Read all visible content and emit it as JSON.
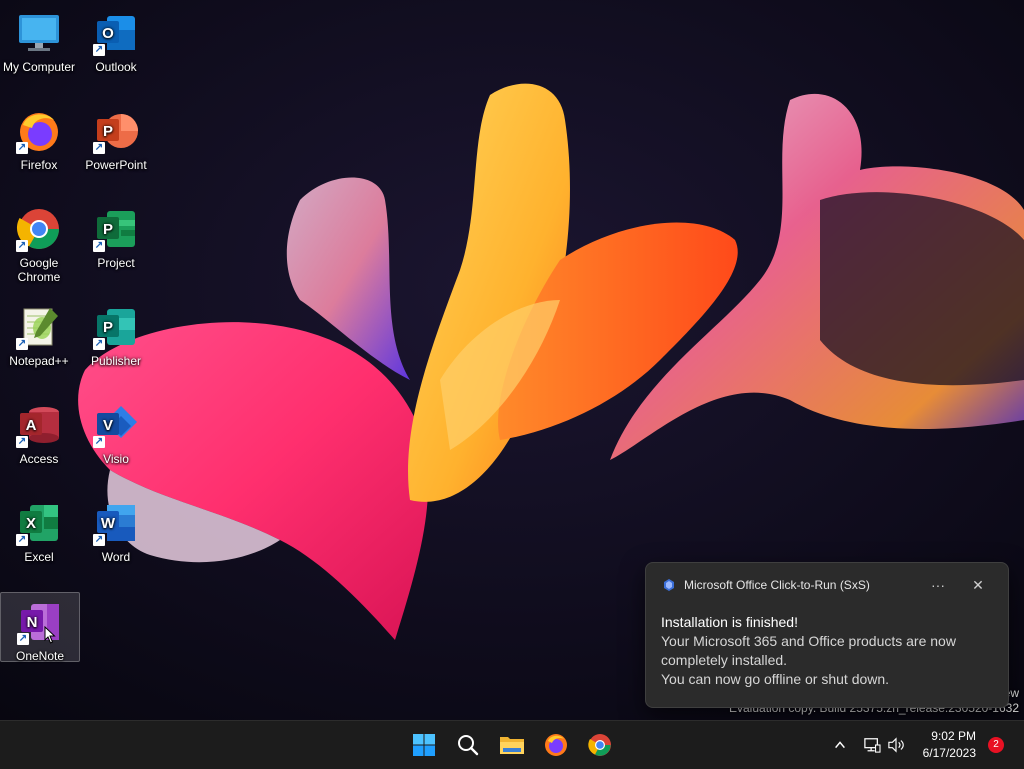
{
  "desktop": {
    "icons": [
      {
        "label": "My Computer",
        "icon": "computer-icon"
      },
      {
        "label": "Outlook",
        "icon": "outlook-icon"
      },
      {
        "label": "Firefox",
        "icon": "firefox-icon"
      },
      {
        "label": "PowerPoint",
        "icon": "powerpoint-icon"
      },
      {
        "label": "Google Chrome",
        "icon": "chrome-icon"
      },
      {
        "label": "Project",
        "icon": "project-icon"
      },
      {
        "label": "Notepad++",
        "icon": "notepadpp-icon"
      },
      {
        "label": "Publisher",
        "icon": "publisher-icon"
      },
      {
        "label": "Access",
        "icon": "access-icon"
      },
      {
        "label": "Visio",
        "icon": "visio-icon"
      },
      {
        "label": "Excel",
        "icon": "excel-icon"
      },
      {
        "label": "Word",
        "icon": "word-icon"
      },
      {
        "label": "OneNote",
        "icon": "onenote-icon"
      }
    ]
  },
  "watermark": {
    "line1": "ew",
    "line2": "Evaluation copy. Build 25375.zn_release.230520-1632"
  },
  "toast": {
    "app_name": "Microsoft Office Click-to-Run (SxS)",
    "more_label": "···",
    "close_label": "✕",
    "title": "Installation is finished!",
    "line1": "Your Microsoft 365 and Office products are now completely installed.",
    "line2": "You can now go offline or shut down."
  },
  "taskbar": {
    "time": "9:02 PM",
    "date": "6/17/2023",
    "notification_count": "2",
    "chevron": "^"
  },
  "colors": {
    "taskbar_bg": "#1c1c1c",
    "toast_bg": "#2b2b2b",
    "windows_blue": "#0078d4",
    "badge_red": "#e81123"
  }
}
